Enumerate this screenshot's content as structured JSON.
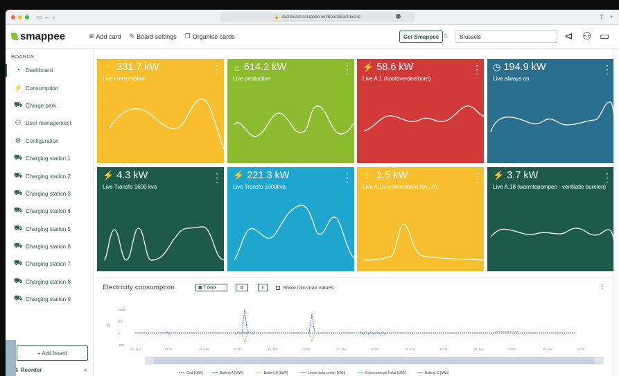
{
  "browser": {
    "url": "dashboard.smappee.net/Board/Dashboard",
    "lock": "🔒"
  },
  "header": {
    "logo": "smappee",
    "add_card": "Add card",
    "board_settings": "Board settings",
    "organise_cards": "Organise cards",
    "get_smappee": "Get Smappee",
    "location": "Brussels"
  },
  "sidebar": {
    "heading": "BOARDS",
    "items": [
      {
        "label": "Dashboard",
        "icon": "dashboard-icon",
        "glyph": "◔"
      },
      {
        "label": "Consumption",
        "icon": "consumption-icon",
        "glyph": "⚡"
      },
      {
        "label": "Charge park",
        "icon": "car-icon",
        "glyph": "⛟"
      },
      {
        "label": "User management",
        "icon": "user-management-icon",
        "glyph": "⚇"
      },
      {
        "label": "Configuration",
        "icon": "configuration-icon",
        "glyph": "⚙"
      },
      {
        "label": "Charging station 1",
        "icon": "car-icon",
        "glyph": "⛟"
      },
      {
        "label": "Charging station 2",
        "icon": "car-icon",
        "glyph": "⛟"
      },
      {
        "label": "Charging station 3",
        "icon": "car-icon",
        "glyph": "⛟"
      },
      {
        "label": "Charging station 4",
        "icon": "car-icon",
        "glyph": "⛟"
      },
      {
        "label": "Charging station 5",
        "icon": "car-icon",
        "glyph": "⛟"
      },
      {
        "label": "Charging station 6",
        "icon": "car-icon",
        "glyph": "⛟"
      },
      {
        "label": "Charging station 7",
        "icon": "car-icon",
        "glyph": "⛟"
      },
      {
        "label": "Charging station 8",
        "icon": "car-icon",
        "glyph": "⛟"
      },
      {
        "label": "Charging station 9",
        "icon": "car-icon",
        "glyph": "⛟"
      }
    ],
    "add_board": "+ Add board",
    "reorder": "Reorder"
  },
  "tiles": [
    {
      "value": "331.7 kW",
      "label": "Live consumption",
      "color": "#f7bf2e",
      "icon": "consumption-icon"
    },
    {
      "value": "614.2 kW",
      "label": "Live production",
      "color": "#8dbb2f",
      "icon": "sun-icon"
    },
    {
      "value": "58.6 kW",
      "label": "Live A.1 (hoofdverdeelbord)",
      "color": "#d23a3a",
      "icon": "consumption-icon"
    },
    {
      "value": "194.9 kW",
      "label": "Live always on",
      "color": "#2b6f8f",
      "icon": "always-on-icon"
    },
    {
      "value": "4.3 kW",
      "label": "Live Transfo 1600 kva",
      "color": "#1d5a4c",
      "icon": "consumption-icon"
    },
    {
      "value": "221.3 kW",
      "label": "Live Transfo 1000kva",
      "color": "#1ea6cf",
      "icon": "consumption-icon"
    },
    {
      "value": "1.5 kW",
      "label": "Live A.16 (verdeelbord HAL A)",
      "color": "#f7bf2e",
      "icon": "consumption-icon"
    },
    {
      "value": "3.7 kW",
      "label": "Live A.18 (warmtepompen - ventilatie burelen)",
      "color": "#1d5a4c",
      "icon": "consumption-icon"
    }
  ],
  "chart_panel": {
    "title": "Electricity consumption",
    "range_button": "7 days",
    "show_minmax": "Show min-max values"
  },
  "chart_data": {
    "type": "line",
    "ylabel": "W",
    "y_ticks": [
      "1000",
      "500",
      "0",
      "-500"
    ],
    "x_ticks": [
      "24. Mar",
      "12:00",
      "25. Mar",
      "12:00",
      "26. Mar",
      "12:00",
      "27. Mar",
      "12:00",
      "28. Mar",
      "12:00",
      "29. Mar",
      "12:00",
      "30. Mar",
      "12:00"
    ],
    "ylim": [
      -500,
      1000
    ],
    "series": [
      {
        "name": "Grid [kWh]",
        "color": "#333333"
      },
      {
        "name": "Batterij A [kWh]",
        "color": "#1f4e9a"
      },
      {
        "name": "Batterij B [kWh]",
        "color": "#8dbb2f"
      },
      {
        "name": "Loods data center [kWh]",
        "color": "#2b5aa8"
      },
      {
        "name": "Zonne-energie Dolat [kWh]",
        "color": "#3aa0c8"
      },
      {
        "name": "Batterij C [kWh]",
        "color": "#555555"
      }
    ],
    "spikes": [
      {
        "x": "26. Mar 00:00",
        "y": 1000
      },
      {
        "x": "26. Mar 00:00",
        "y": -400
      },
      {
        "x": "27. Mar 00:00",
        "y": 800
      },
      {
        "x": "27. Mar 00:00",
        "y": -350
      }
    ]
  }
}
